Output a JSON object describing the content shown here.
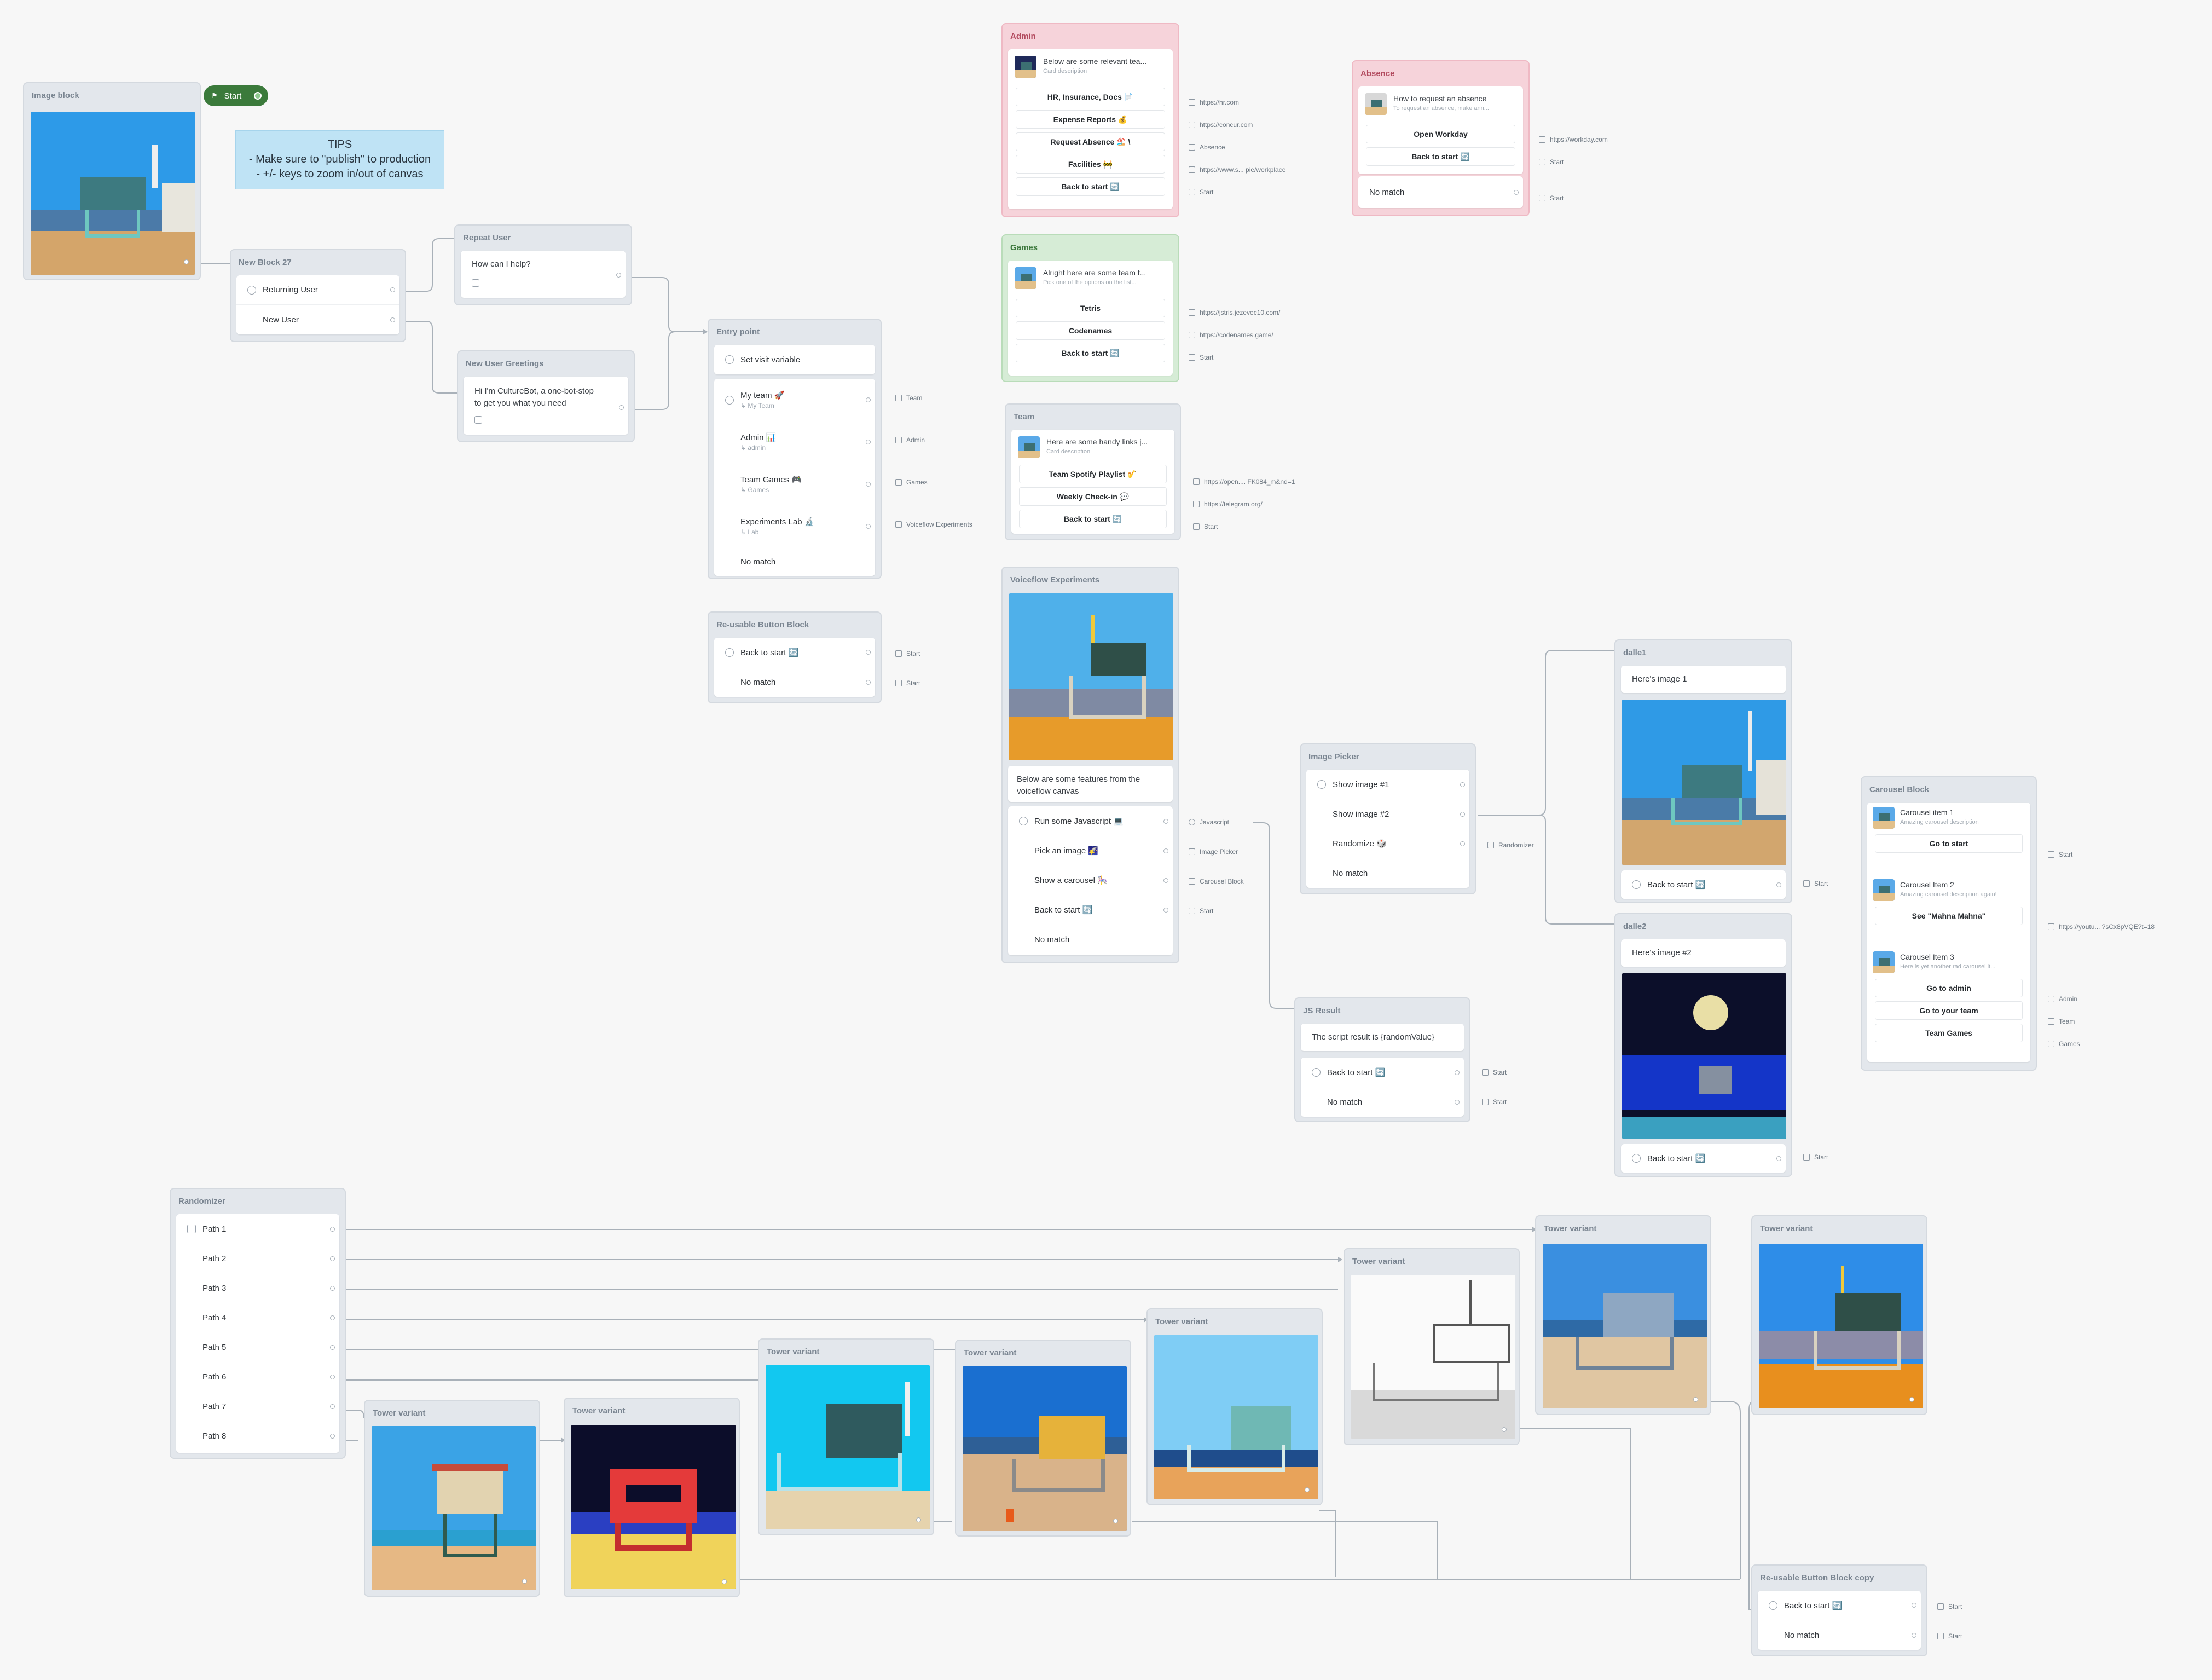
{
  "start": {
    "label": "Start"
  },
  "tips": {
    "title": "TIPS",
    "line1": "- Make sure to \"publish\" to production",
    "line2": "- +/- keys to zoom in/out of canvas"
  },
  "image_block": {
    "title": "Image block"
  },
  "new_block_27": {
    "title": "New Block 27",
    "returning": "Returning User",
    "new": "New User"
  },
  "repeat_user": {
    "title": "Repeat User",
    "text": "How can I help?"
  },
  "new_user_greetings": {
    "title": "New User Greetings",
    "text1": "Hi I'm CultureBot, a one-bot-stop",
    "text2": "to get you what you need"
  },
  "entry_point": {
    "title": "Entry point",
    "set_visit": "Set visit variable",
    "items": [
      {
        "label": "My team 🚀",
        "sub": "↳ My Team",
        "target": "Team"
      },
      {
        "label": "Admin 📊",
        "sub": "↳ admin",
        "target": "Admin"
      },
      {
        "label": "Team Games 🎮",
        "sub": "↳ Games",
        "target": "Games"
      },
      {
        "label": "Experiments Lab 🔬",
        "sub": "↳ Lab",
        "target": "Voiceflow Experiments"
      }
    ],
    "no_match": "No match"
  },
  "reusable": {
    "title": "Re-usable Button Block",
    "back": "Back to start 🔄",
    "no_match": "No match",
    "target1": "Start",
    "target2": "Start"
  },
  "admin": {
    "title": "Admin",
    "card_title": "Below are some relevant tea...",
    "card_desc": "Card description",
    "buttons": [
      "HR, Insurance, Docs 📄",
      "Expense Reports 💰",
      "Request Absence 🏖️ \\",
      "Facilities 🚧",
      "Back to start 🔄"
    ],
    "targets": [
      "https://hr.com",
      "https://concur.com",
      "Absence",
      "https://www.s... pie/workplace",
      "Start"
    ]
  },
  "absence": {
    "title": "Absence",
    "card_title": "How to request an absence",
    "card_desc": "To request an absence, make ann...",
    "buttons": [
      "Open Workday",
      "Back to start 🔄"
    ],
    "targets": [
      "https://workday.com",
      "Start"
    ],
    "no_match": "No match",
    "no_match_target": "Start"
  },
  "games": {
    "title": "Games",
    "card_title": "Alright here are some team f...",
    "card_desc": "Pick one of the options on the list...",
    "buttons": [
      "Tetris",
      "Codenames",
      "Back to start 🔄"
    ],
    "targets": [
      "https://jstris.jezevec10.com/",
      "https://codenames.game/",
      "Start"
    ]
  },
  "team": {
    "title": "Team",
    "card_title": "Here are some handy links j...",
    "card_desc": "Card description",
    "buttons": [
      "Team Spotify Playlist 🎷",
      "Weekly Check-in 💬",
      "Back to start 🔄"
    ],
    "targets": [
      "https://open.... FK084_m&nd=1",
      "https://telegram.org/",
      "Start"
    ]
  },
  "voiceflow_experiments": {
    "title": "Voiceflow Experiments",
    "text1": "Below are some features from the",
    "text2": "voiceflow canvas",
    "items": [
      {
        "label": "Run some Javascript 💻",
        "target": "Javascript"
      },
      {
        "label": "Pick an image 🌠",
        "target": "Image Picker"
      },
      {
        "label": "Show a carousel 🎠",
        "target": "Carousel Block"
      },
      {
        "label": "Back to start 🔄",
        "target": "Start"
      }
    ],
    "no_match": "No match"
  },
  "image_picker": {
    "title": "Image Picker",
    "items": [
      "Show image #1",
      "Show image #2",
      "Randomize 🎲"
    ],
    "randomizer_target": "Randomizer",
    "no_match": "No match"
  },
  "js_result": {
    "title": "JS Result",
    "text": "The script result is {randomValue}",
    "back": "Back to start 🔄",
    "no_match": "No match",
    "target1": "Start",
    "target2": "Start"
  },
  "dalle1": {
    "title": "dalle1",
    "text": "Here's image 1",
    "back": "Back to start 🔄",
    "target": "Start"
  },
  "dalle2": {
    "title": "dalle2",
    "text": "Here's image #2",
    "back": "Back to start 🔄",
    "target": "Start"
  },
  "carousel": {
    "title": "Carousel Block",
    "items": [
      {
        "title": "Carousel item 1",
        "desc": "Amazing carousel description",
        "buttons": [
          "Go to start"
        ],
        "targets": [
          "Start"
        ]
      },
      {
        "title": "Carousel Item 2",
        "desc": "Amazing carousel description again!",
        "buttons": [
          "See \"Mahna Mahna\""
        ],
        "targets": [
          "https://youtu... ?sCx8pVQE?t=18"
        ]
      },
      {
        "title": "Carousel Item 3",
        "desc": "Here is yet another rad carousel it...",
        "buttons": [
          "Go to admin",
          "Go to your team",
          "Team Games"
        ],
        "targets": [
          "Admin",
          "Team",
          "Games"
        ]
      }
    ]
  },
  "randomizer": {
    "title": "Randomizer",
    "paths": [
      "Path 1",
      "Path 2",
      "Path 3",
      "Path 4",
      "Path 5",
      "Path 6",
      "Path 7",
      "Path 8"
    ]
  },
  "tower_variant": {
    "title": "Tower variant"
  },
  "reusable_copy": {
    "title": "Re-usable Button Block copy",
    "back": "Back to start 🔄",
    "no_match": "No match",
    "target1": "Start",
    "target2": "Start"
  },
  "colors": {
    "canvas": "#f7f7f7",
    "block": "#e3e7ec",
    "admin": "#f6d3da",
    "games": "#d6ecd6",
    "start": "#3b7a3b",
    "tips": "#bfe3f5"
  }
}
